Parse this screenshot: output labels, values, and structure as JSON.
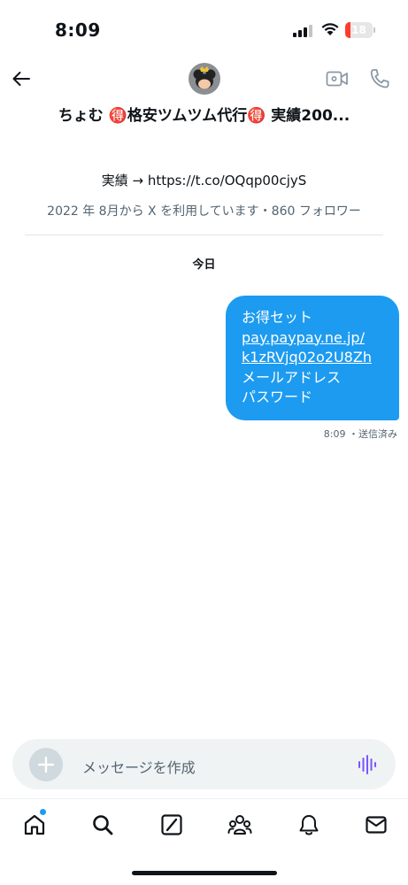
{
  "status_bar": {
    "time": "8:09",
    "battery": "18",
    "battery_level": 0.18,
    "battery_color": "#ff3b30"
  },
  "header": {
    "title": "ちょむ 🉐格安ツムツム代行🉐 実績200...",
    "icons": [
      "back-arrow-icon",
      "video-call-icon",
      "phone-call-icon"
    ]
  },
  "profile": {
    "bio": "実績 → https://t.co/OQqp00cjyS",
    "meta": "2022 年 8月から X を利用しています・860 フォロワー"
  },
  "conversation": {
    "day_label": "今日",
    "messages": [
      {
        "lines": [
          "お得セット",
          "pay.paypay.ne.jp/",
          "k1zRVjq02o2U8Zh",
          "メールアドレス",
          "パスワード"
        ],
        "time_status": "8:09 ・送信済み"
      }
    ]
  },
  "composer": {
    "placeholder": "メッセージを作成"
  },
  "tabs": [
    "home-icon",
    "search-icon",
    "grok-icon",
    "communities-icon",
    "notifications-icon",
    "messages-icon"
  ],
  "colors": {
    "accent": "#1d9bf0",
    "voice": "#7856ff"
  }
}
